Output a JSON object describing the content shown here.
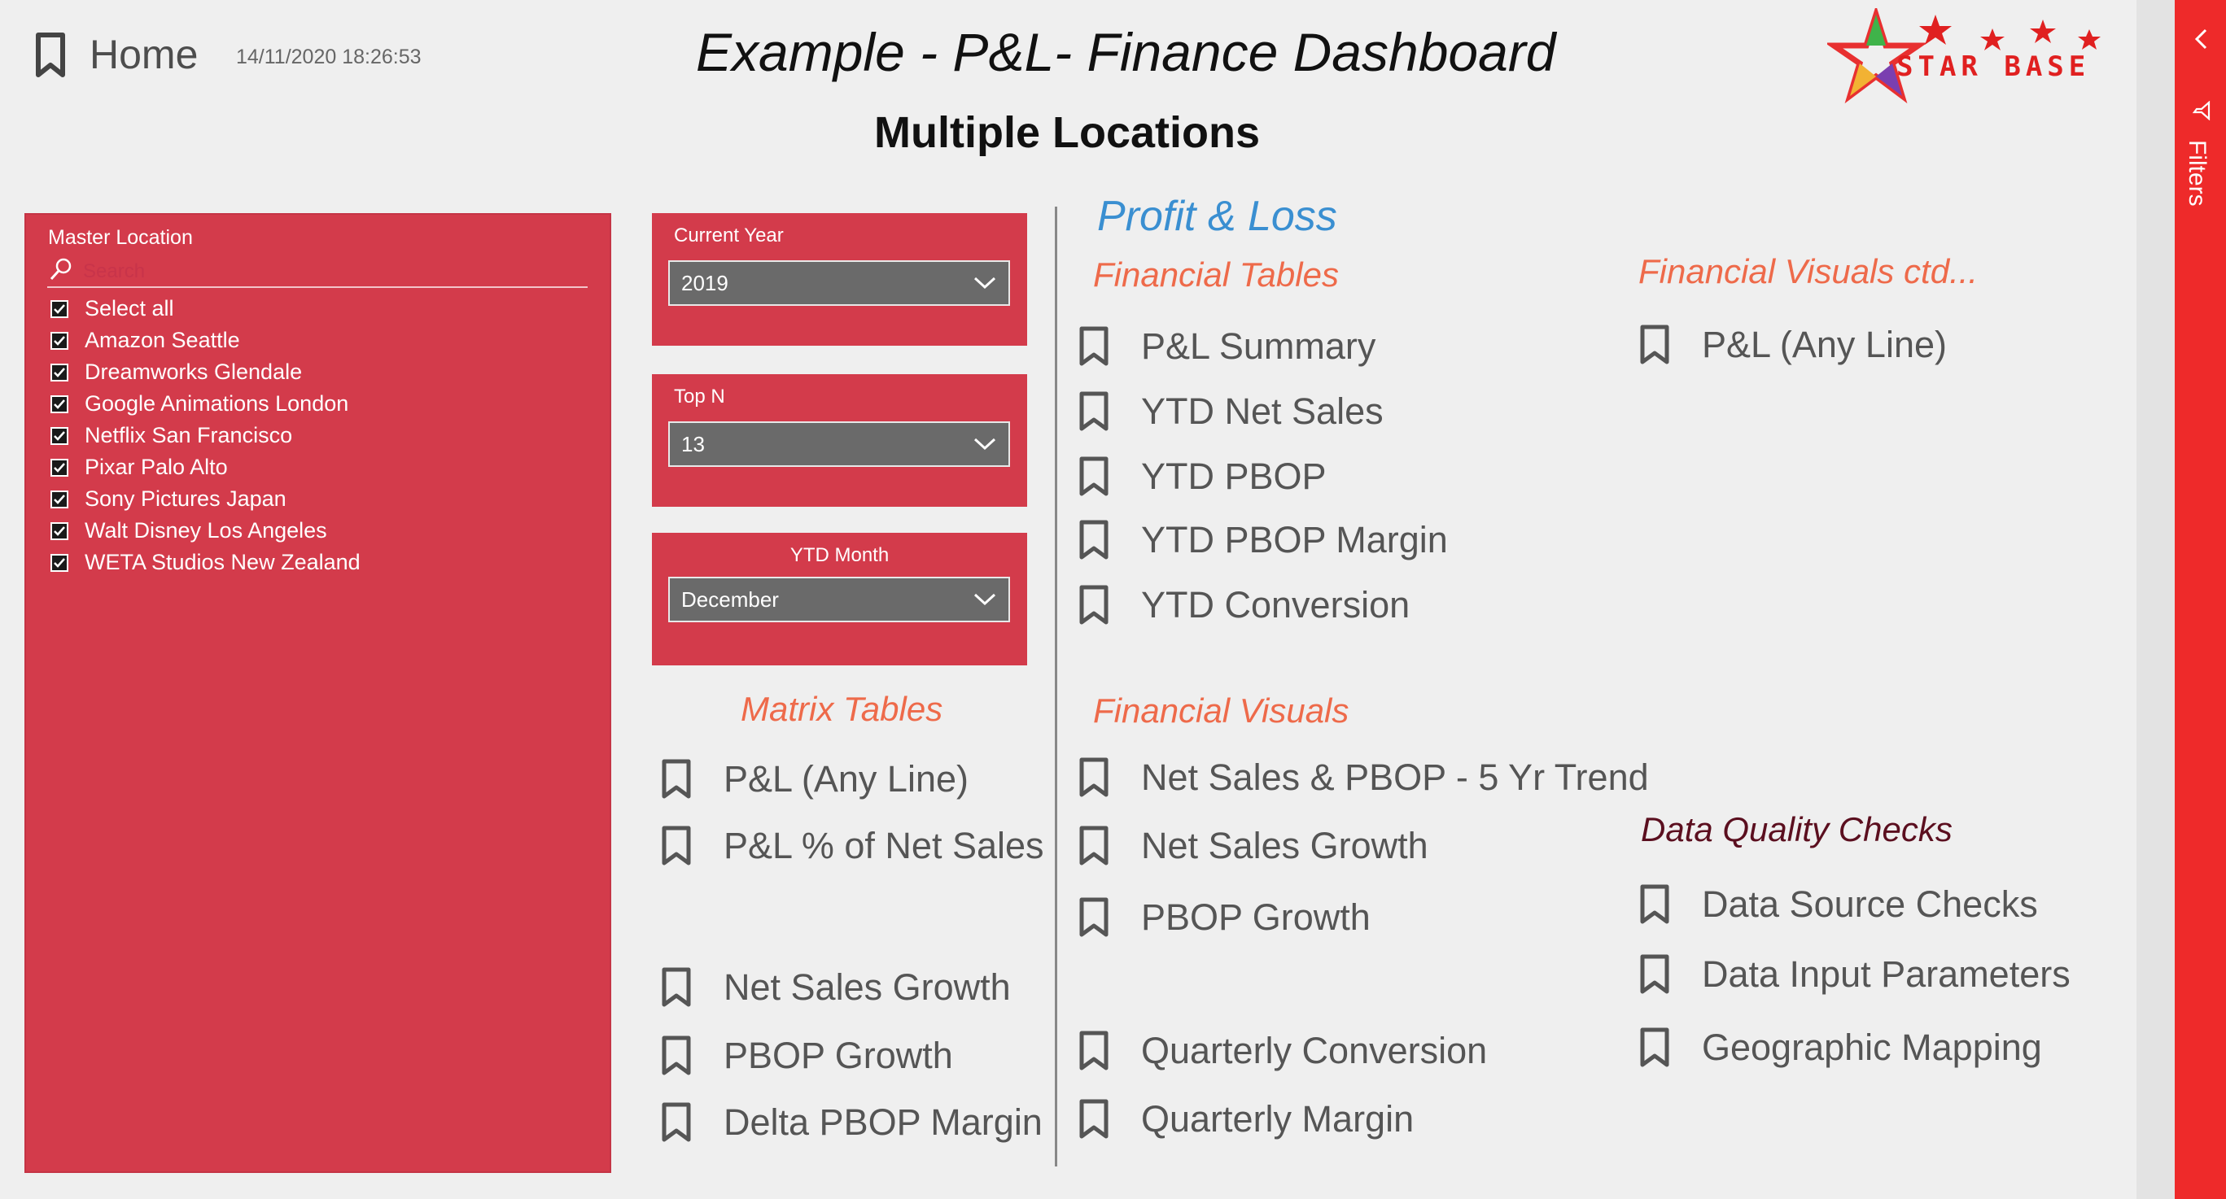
{
  "header": {
    "home_label": "Home",
    "timestamp": "14/11/2020 18:26:53",
    "title_em": "Example",
    "title_rest": " - P&L- Finance Dashboard",
    "subtitle": "Multiple Locations",
    "logo_text": "STAR BASE"
  },
  "slicer": {
    "title": "Master Location",
    "search_placeholder": "Search",
    "items": [
      {
        "label": "Select all",
        "checked": true
      },
      {
        "label": "Amazon Seattle",
        "checked": true
      },
      {
        "label": "Dreamworks Glendale",
        "checked": true
      },
      {
        "label": "Google Animations London",
        "checked": true
      },
      {
        "label": "Netflix San Francisco",
        "checked": true
      },
      {
        "label": "Pixar Palo Alto",
        "checked": true
      },
      {
        "label": "Sony Pictures Japan",
        "checked": true
      },
      {
        "label": "Walt Disney Los Angeles",
        "checked": true
      },
      {
        "label": "WETA Studios New Zealand",
        "checked": true
      }
    ]
  },
  "dropdowns": {
    "current_year": {
      "label": "Current Year",
      "value": "2019"
    },
    "top_n": {
      "label": "Top N",
      "value": "13"
    },
    "ytd_month": {
      "label": "YTD Month",
      "value": "December"
    }
  },
  "matrix_tables": {
    "heading": "Matrix Tables",
    "links": [
      "P&L (Any Line)",
      "P&L % of Net Sales",
      "Net Sales Growth",
      "PBOP Growth",
      "Delta PBOP Margin"
    ]
  },
  "profit_loss": {
    "heading": "Profit & Loss",
    "financial_tables": {
      "heading": "Financial Tables",
      "links": [
        "P&L Summary",
        "YTD Net Sales",
        "YTD PBOP",
        "YTD PBOP Margin",
        "YTD Conversion"
      ]
    },
    "financial_visuals": {
      "heading": "Financial Visuals",
      "links": [
        "Net Sales & PBOP - 5 Yr Trend",
        "Net Sales Growth",
        "PBOP Growth",
        "Quarterly Conversion",
        "Quarterly Margin"
      ]
    },
    "financial_visuals_ctd": {
      "heading": "Financial Visuals ctd...",
      "links": [
        "P&L (Any Line)"
      ]
    },
    "data_quality": {
      "heading": "Data Quality Checks",
      "links": [
        "Data Source Checks",
        "Data Input Parameters",
        "Geographic Mapping"
      ]
    }
  },
  "filters_pane": {
    "label": "Filters"
  },
  "colors": {
    "slicer_bg": "#d33b4b",
    "accent_orange": "#ee6a4a",
    "accent_blue": "#3a8fd1",
    "filter_pane": "#ee2a2a"
  }
}
